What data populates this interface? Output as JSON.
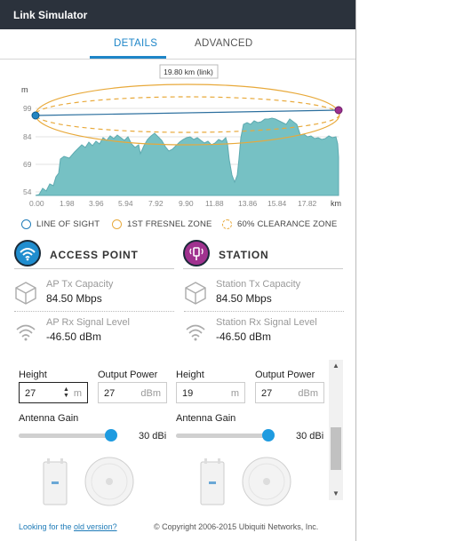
{
  "window": {
    "title": "Link Simulator"
  },
  "tabs": [
    {
      "label": "DETAILS",
      "active": true
    },
    {
      "label": "ADVANCED",
      "active": false
    }
  ],
  "profile": {
    "link_label": "19.80 km (link)",
    "y_unit": "m",
    "x_unit": "km",
    "y_ticks": [
      "99",
      "84",
      "69",
      "54"
    ],
    "x_ticks": [
      "0.00",
      "1.98",
      "3.96",
      "5.94",
      "7.92",
      "9.90",
      "11.88",
      "13.86",
      "15.84",
      "17.82"
    ],
    "colors": {
      "terrain": "#76c1c4",
      "line_of_sight": "#2b6f9e",
      "fresnel": "#e8a93a",
      "ap_end": "#2385c1",
      "station_end": "#9b2f90"
    }
  },
  "legend": {
    "line_of_sight": "LINE OF SIGHT",
    "fresnel": "1ST FRESNEL ZONE",
    "clearance": "60% CLEARANCE ZONE"
  },
  "access_point": {
    "title": "ACCESS POINT",
    "icon": "wifi-icon",
    "tx_label": "AP Tx Capacity",
    "tx_value": "84.50 Mbps",
    "rx_label": "AP Rx Signal Level",
    "rx_value": "-46.50 dBm",
    "height_label": "Height",
    "height_value": "27",
    "height_unit": "m",
    "power_label": "Output Power",
    "power_value": "27",
    "power_unit": "dBm",
    "gain_label": "Antenna Gain",
    "gain_value": "30 dBi"
  },
  "station": {
    "title": "STATION",
    "icon": "antenna-tower-icon",
    "tx_label": "Station Tx Capacity",
    "tx_value": "84.50 Mbps",
    "rx_label": "Station Rx Signal Level",
    "rx_value": "-46.50 dBm",
    "height_label": "Height",
    "height_value": "19",
    "height_unit": "m",
    "power_label": "Output Power",
    "power_value": "27",
    "power_unit": "dBm",
    "gain_label": "Antenna Gain",
    "gain_value": "30 dBi"
  },
  "footer": {
    "link_prefix": "Looking for the ",
    "link_text": "old version?",
    "copyright": "© Copyright 2006-2015 Ubiquiti Networks, Inc."
  }
}
